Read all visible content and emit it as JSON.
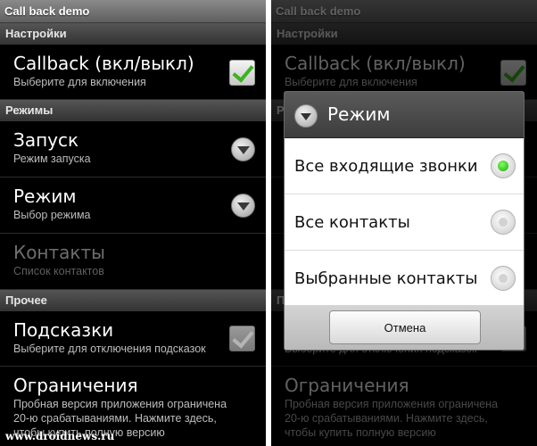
{
  "app_title": "Call back demo",
  "sections": {
    "settings": "Настройки",
    "modes": "Режимы",
    "other": "Прочее"
  },
  "prefs": {
    "callback": {
      "title": "Callback (вкл/выкл)",
      "summary": "Выберите для включения",
      "checked": true
    },
    "launch": {
      "title": "Запуск",
      "summary": "Режим запуска"
    },
    "mode": {
      "title": "Режим",
      "summary": "Выбор режима"
    },
    "contacts": {
      "title": "Контакты",
      "summary": "Список контактов",
      "enabled": false
    },
    "hints": {
      "title": "Подсказки",
      "summary": "Выберите для отключения подсказок",
      "checked": true,
      "enabled": false
    },
    "limits": {
      "title": "Ограничения",
      "summary_line1": "Пробная версия приложения ограничена",
      "summary_line2": "20-ю срабатываниями. Нажмите здесь,",
      "summary_line3": "чтобы купить полную версию"
    }
  },
  "dialog": {
    "title": "Режим",
    "options": [
      {
        "label": "Все входящие звонки",
        "selected": true
      },
      {
        "label": "Все контакты",
        "selected": false
      },
      {
        "label": "Выбранные контакты",
        "selected": false
      }
    ],
    "cancel_label": "Отмена"
  },
  "watermark": "www.droidnews.ru",
  "colors": {
    "check_green": "#3bb31d",
    "radio_selected": "#1fa80d",
    "background": "#000000"
  },
  "icons": {
    "checkbox": "check-icon",
    "dropdown": "chevron-down-icon",
    "radio": "radio-icon"
  }
}
